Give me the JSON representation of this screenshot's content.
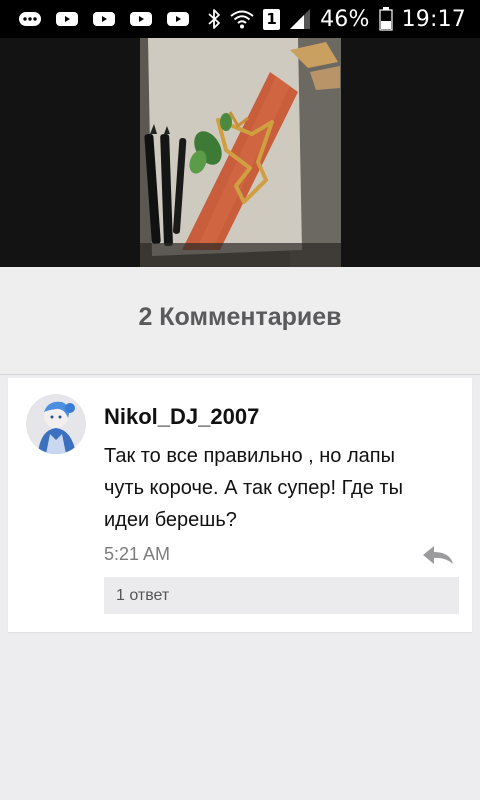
{
  "status_bar": {
    "notification_icons": [
      "chat-bubble-icon",
      "youtube-icon",
      "youtube-icon",
      "youtube-icon",
      "youtube-icon"
    ],
    "system_icons": [
      "bluetooth-icon",
      "wifi-icon",
      "sim1-icon",
      "signal-icon"
    ],
    "sim_label": "1",
    "battery_percent": "46%",
    "battery_level": 0.46,
    "time": "19:17"
  },
  "post": {
    "image_description_icon": "artwork-photo"
  },
  "comments": {
    "title": "2 Комментариев",
    "items": [
      {
        "author": "Nikol_DJ_2007",
        "avatar_icon": "user-avatar",
        "text": "Так то все правильно , но лапы чуть короче. А так супер! Где ты идеи берешь?",
        "time": "5:21 AM",
        "replies_label": "1 ответ"
      }
    ]
  },
  "colors": {
    "status_bar_bg": "#000000",
    "photo_bg": "#141314",
    "page_bg": "#edecee",
    "card_bg": "#ffffff",
    "title_text": "#5a5a5c",
    "meta_text": "#7c7c7e"
  }
}
